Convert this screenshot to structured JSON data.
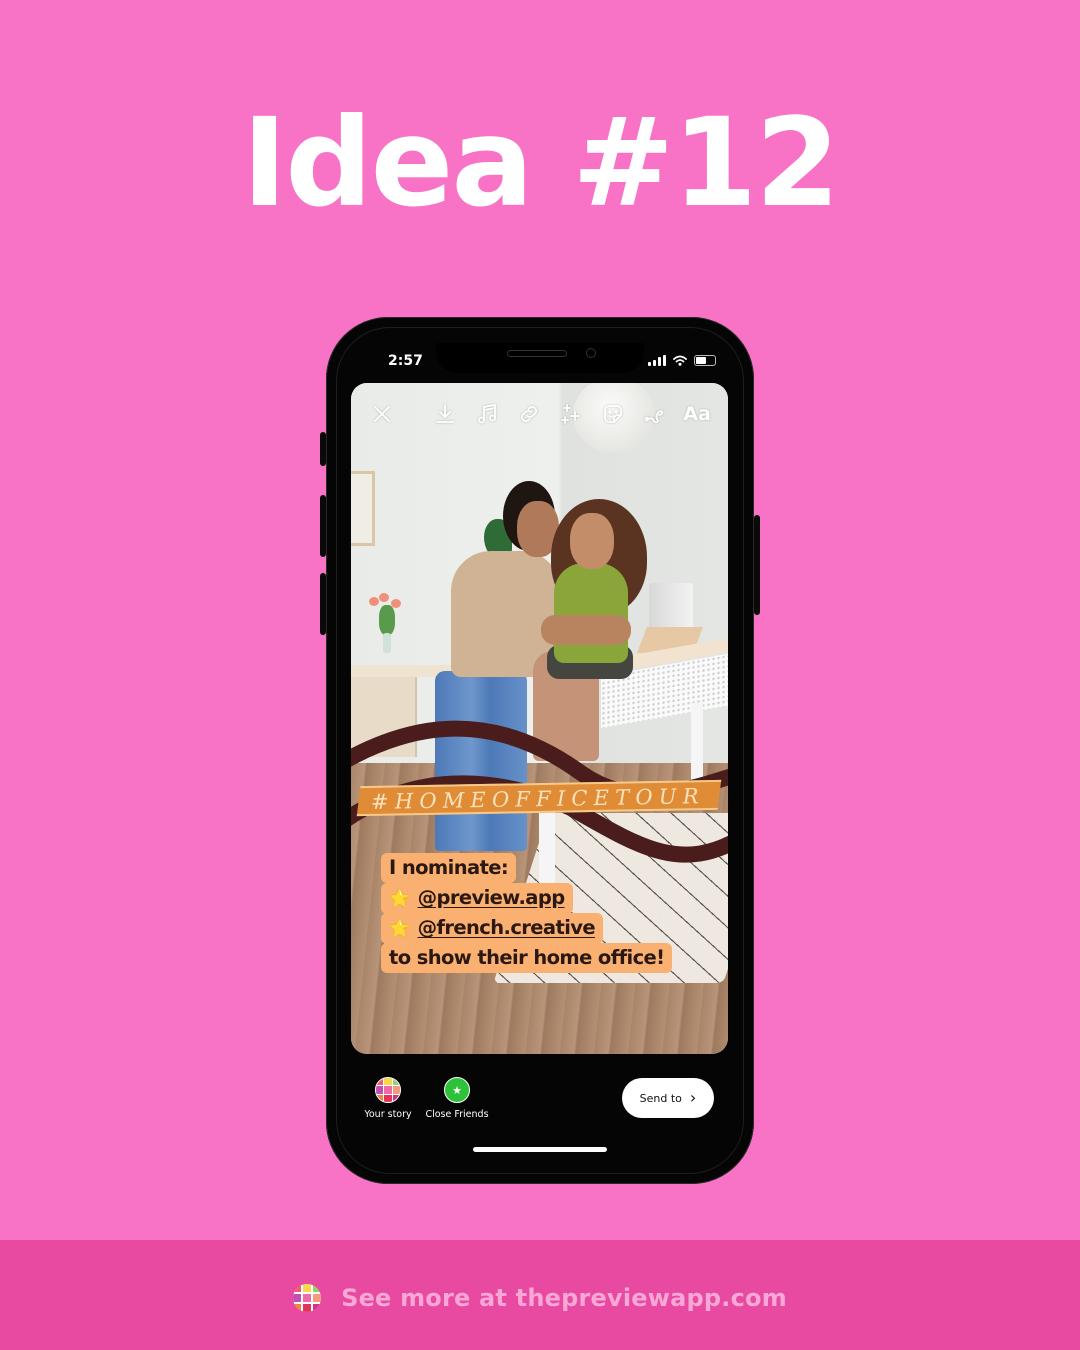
{
  "headline": "Idea #12",
  "phone": {
    "status_bar": {
      "time": "2:57",
      "signal_icon": "cellular-signal-icon",
      "wifi_icon": "wifi-icon",
      "battery_icon": "battery-icon",
      "battery_level_percent": 55
    },
    "story_toolbar": {
      "close": "close-icon",
      "download": "download-icon",
      "music": "music-icon",
      "link": "link-icon",
      "effects": "sparkles-icon",
      "sticker": "sticker-icon",
      "draw": "draw-icon",
      "text_label": "Aa"
    },
    "story": {
      "hashtag_sticker": "#HOMEOFFICETOUR",
      "nomination_lines": [
        {
          "star": "⭐",
          "text": "I nominate:"
        },
        {
          "star": "⭐",
          "handle": "@preview.app"
        },
        {
          "star": "⭐",
          "handle": "@french.creative"
        },
        {
          "text": "to show their home office!"
        }
      ],
      "colors": {
        "text_bg": "#f9b070",
        "text_color": "#2b1812",
        "wave": "#4a1c1c",
        "hashtag_band": "#e08c36"
      }
    },
    "share_bar": {
      "your_story_label": "Your story",
      "close_friends_label": "Close Friends",
      "close_friends_icon": "★",
      "send_label": "Send to",
      "send_chevron": "›"
    }
  },
  "footer": {
    "text": "See more at thepreviewapp.com",
    "logo_colors": [
      "#f15b6c",
      "#f7d84a",
      "#8fd46b",
      "#c34fb5",
      "#ef6aa6",
      "#f29a7b",
      "#f0823a",
      "#e2345a",
      "#d0367e"
    ]
  },
  "colors": {
    "background": "#f872c5",
    "footer_bg": "#e84aa2",
    "footer_text": "#f8a7d6",
    "headline": "#ffffff"
  }
}
